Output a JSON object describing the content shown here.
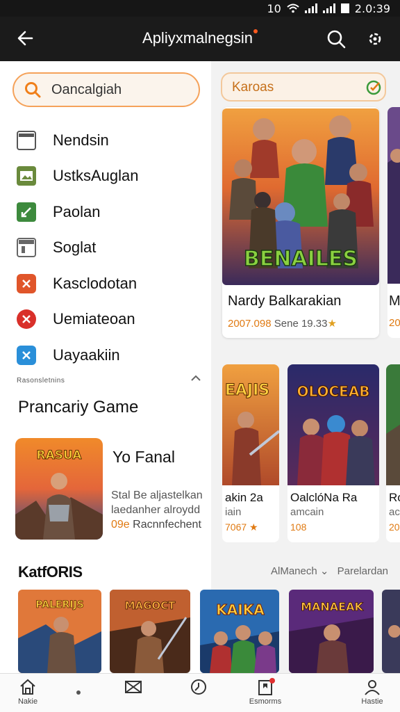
{
  "status": {
    "network": "10",
    "time": "2.0:39"
  },
  "appbar": {
    "title": "Apliyxmalnegsin"
  },
  "search": {
    "placeholder": "Oancalgiah"
  },
  "categories": [
    {
      "label": "Nendsin",
      "icon": "window-icon",
      "color": "#555555"
    },
    {
      "label": "UstksAuglan",
      "icon": "image-icon",
      "color": "#6a8a3c"
    },
    {
      "label": "Paolan",
      "icon": "check-icon",
      "color": "#3d8a3d"
    },
    {
      "label": "Soglat",
      "icon": "calendar-icon",
      "color": "#666666"
    },
    {
      "label": "Kasclodotan",
      "icon": "cross-icon",
      "color": "#e0552a"
    },
    {
      "label": "Uemiateoan",
      "icon": "cross-icon",
      "color": "#d9302a"
    },
    {
      "label": "Uayaakiin",
      "icon": "cross-icon",
      "color": "#2a8fd9"
    }
  ],
  "section_small": "Rasonsletnins",
  "popular": {
    "title": "Prancariy Game",
    "featured": {
      "art_title": "RASUA",
      "title": "Yo Fanal",
      "desc1": "Stal Be aljastelkan",
      "desc2": "laedanher alroydd",
      "meta_price": "09e",
      "meta_text": "Racnnfechent"
    }
  },
  "filter": {
    "label": "Karoas"
  },
  "main_card": {
    "art_title": "BENAILES",
    "name": "Nardy Balkarakian",
    "meta_price": "2007.098",
    "meta_text": "Sene 19.33"
  },
  "card2": {
    "art_title": "EAJIS",
    "name": "akin 2a",
    "sub": "iain",
    "meta": "7067"
  },
  "card3": {
    "art_title": "OLOCEAB",
    "name": "OalclóNa Ra",
    "sub": "amcain",
    "meta": "108"
  },
  "peek2": {
    "name": "Ro",
    "sub": "aca",
    "meta": "20"
  },
  "peek1": {
    "name": "M",
    "meta": "20"
  },
  "katoris": {
    "title": "KatfORIS",
    "link1": "AlManech",
    "link2": "Parelardan",
    "tiles": [
      "PALERIJS",
      "MAGOCT",
      "KAIKA",
      "MANAEAK"
    ]
  },
  "bottom_nav": [
    {
      "label": "Nakie",
      "icon": "home-icon"
    },
    {
      "label": "",
      "icon": "envelope-icon"
    },
    {
      "label": "",
      "icon": "clock-icon"
    },
    {
      "label": "Esmorms",
      "icon": "bookmark-icon"
    },
    {
      "label": "Hastie",
      "icon": "profile-icon"
    }
  ],
  "colors": {
    "accent": "#e07a12",
    "appbar": "#1b1b1b",
    "search_border": "#f5a25a"
  }
}
